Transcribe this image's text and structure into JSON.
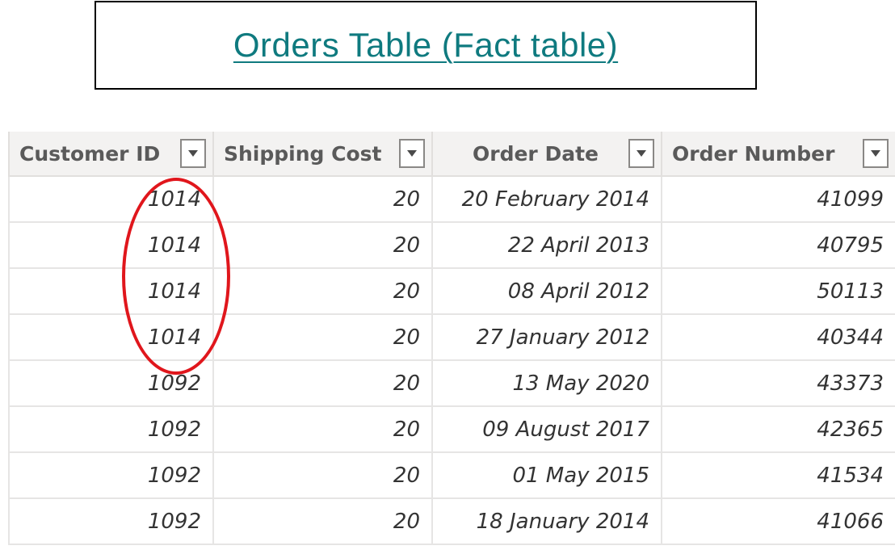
{
  "title": {
    "text": "Orders Table (Fact table)"
  },
  "table": {
    "columns": [
      {
        "label": "Customer ID",
        "icon": "chevron-down-icon"
      },
      {
        "label": "Shipping Cost",
        "icon": "chevron-down-icon"
      },
      {
        "label": "Order Date",
        "icon": "chevron-down-icon"
      },
      {
        "label": "Order Number",
        "icon": "chevron-down-icon"
      }
    ],
    "rows": [
      {
        "customer_id": "1014",
        "shipping_cost": "20",
        "order_date": "20 February 2014",
        "order_number": "41099"
      },
      {
        "customer_id": "1014",
        "shipping_cost": "20",
        "order_date": "22 April 2013",
        "order_number": "40795"
      },
      {
        "customer_id": "1014",
        "shipping_cost": "20",
        "order_date": "08 April 2012",
        "order_number": "50113"
      },
      {
        "customer_id": "1014",
        "shipping_cost": "20",
        "order_date": "27 January 2012",
        "order_number": "40344"
      },
      {
        "customer_id": "1092",
        "shipping_cost": "20",
        "order_date": "13 May 2020",
        "order_number": "43373"
      },
      {
        "customer_id": "1092",
        "shipping_cost": "20",
        "order_date": "09 August 2017",
        "order_number": "42365"
      },
      {
        "customer_id": "1092",
        "shipping_cost": "20",
        "order_date": "01 May 2015",
        "order_number": "41534"
      },
      {
        "customer_id": "1092",
        "shipping_cost": "20",
        "order_date": "18 January 2014",
        "order_number": "41066"
      }
    ]
  },
  "annotation": {
    "shape": "ellipse",
    "color": "#e0161c",
    "highlights": "customer-id-1014-rows"
  },
  "colors": {
    "title_link": "#0f7a7f",
    "header_bg": "#f3f2f1",
    "grid_line": "#e6e5e4",
    "annotation": "#e0161c"
  }
}
